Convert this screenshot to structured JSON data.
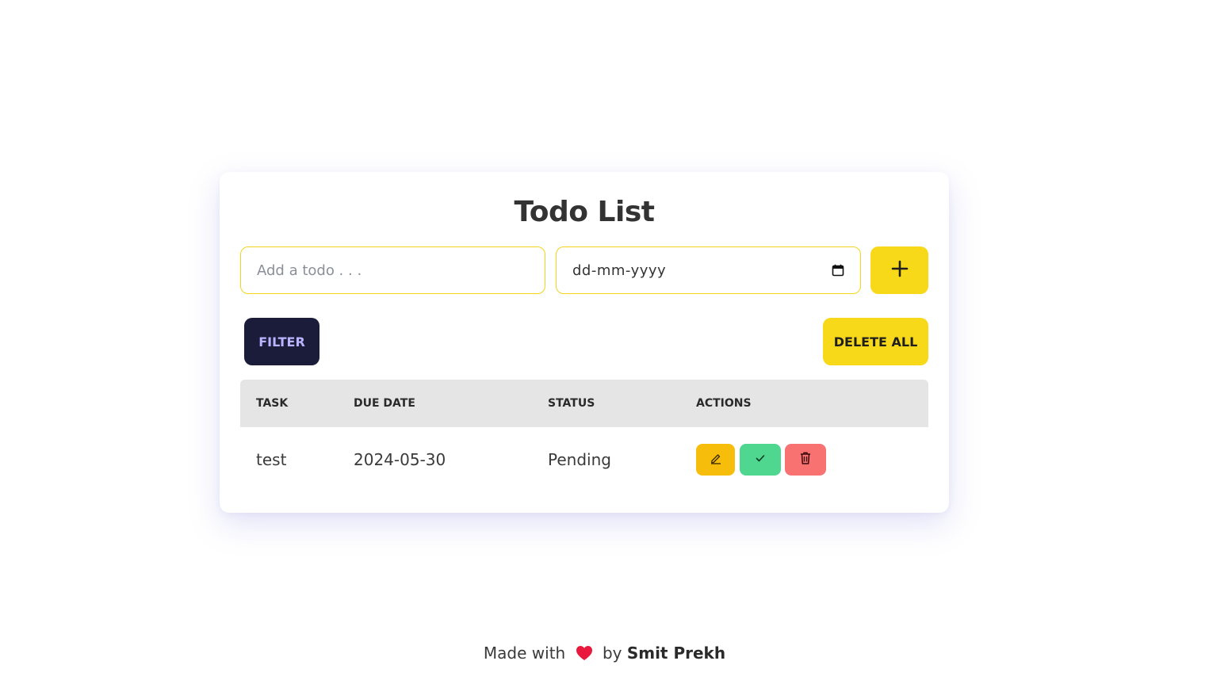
{
  "app": {
    "title": "Todo List"
  },
  "form": {
    "todo_placeholder": "Add a todo . . .",
    "date_placeholder": "dd-mm-yyyy",
    "add_icon": "plus-icon"
  },
  "toolbar": {
    "filter_label": "FILTER",
    "delete_all_label": "DELETE ALL"
  },
  "table": {
    "headers": [
      "TASK",
      "DUE DATE",
      "STATUS",
      "ACTIONS"
    ],
    "rows": [
      {
        "task": "test",
        "due_date": "2024-05-30",
        "status": "Pending",
        "actions": [
          "edit-icon",
          "check-icon",
          "trash-icon"
        ]
      }
    ]
  },
  "footer": {
    "made_with": "Made with",
    "by": "by",
    "author": "Smit Prekh",
    "icon": "heart-icon"
  },
  "colors": {
    "accent_yellow": "#f7d91a",
    "filter_bg": "#1b1b3a",
    "filter_text": "#b8b4ff",
    "edit": "#f7bd0b",
    "complete": "#4fd68f",
    "delete": "#f87272"
  }
}
